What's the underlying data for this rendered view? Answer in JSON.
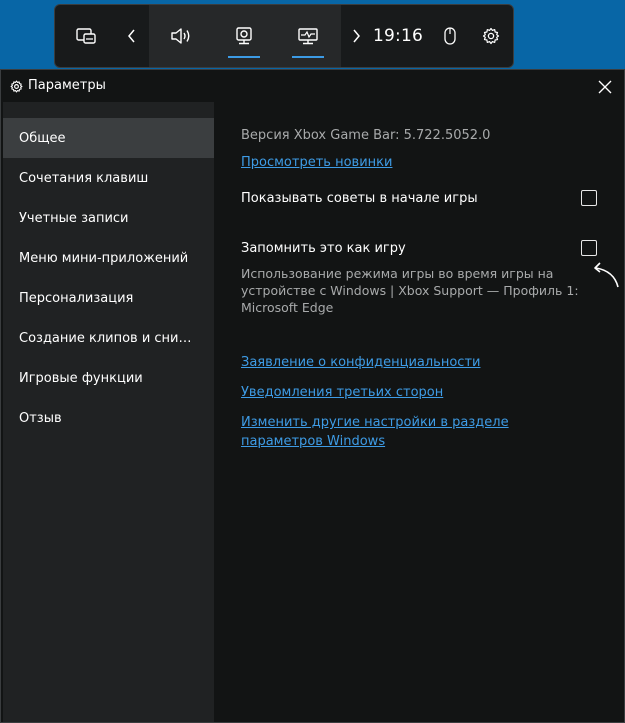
{
  "gamebar": {
    "time": "19:16",
    "icons": [
      "widget-menu-icon",
      "chevron-left-icon",
      "audio-icon",
      "capture-icon",
      "performance-icon",
      "chevron-right-icon",
      "mouse-icon",
      "gear-icon"
    ]
  },
  "window": {
    "title": "Параметры"
  },
  "sidebar": {
    "items": [
      {
        "label": "Общее"
      },
      {
        "label": "Сочетания клавиш"
      },
      {
        "label": "Учетные записи"
      },
      {
        "label": "Меню мини-приложений"
      },
      {
        "label": "Персонализация"
      },
      {
        "label": "Создание клипов и снимков экрана"
      },
      {
        "label": "Игровые функции"
      },
      {
        "label": "Отзыв"
      }
    ],
    "active_index": 0
  },
  "content": {
    "version_text": "Версия Xbox Game Bar: 5.722.5052.0",
    "whats_new_link": "Просмотреть новинки",
    "show_tips_label": "Показывать советы в начале игры",
    "show_tips_checked": false,
    "remember_game_label": "Запомнить это как игру",
    "remember_game_checked": false,
    "game_description": "Использование режима игры во время игры на устройстве с Windows | Xbox Support — Профиль 1: Microsoft Edge",
    "privacy_link": "Заявление о конфиденциальности",
    "third_party_link": "Уведомления третьих сторон",
    "other_settings_link": "Изменить другие настройки в разделе параметров Windows"
  },
  "colors": {
    "desktop": "#0866a6",
    "accent": "#3e9ce6",
    "window_bg": "#121414",
    "sidebar_bg": "#202223",
    "active_item_bg": "#3b3e40"
  }
}
